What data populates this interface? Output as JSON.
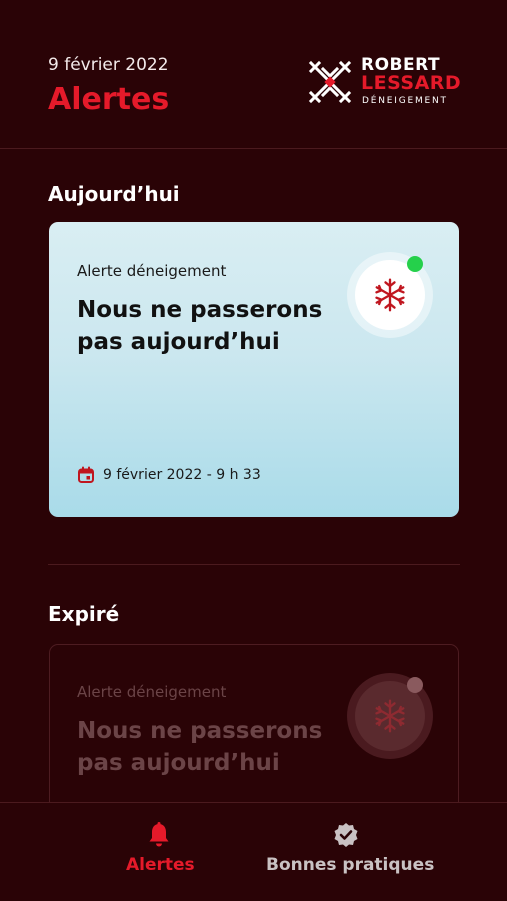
{
  "header": {
    "date": "9 février 2022",
    "title": "Alertes",
    "logo": {
      "line1": "ROBERT",
      "line2": "LESSARD",
      "line3": "DÉNEIGEMENT"
    }
  },
  "sections": {
    "today": "Aujourd’hui",
    "expired": "Expiré"
  },
  "today_card": {
    "kicker": "Alerte déneigement",
    "headline": "Nous ne passerons pas aujourd’hui",
    "timestamp": "9 février 2022 - 9 h 33",
    "status_color": "#25d04b",
    "icon": "snowflake-icon"
  },
  "expired_card": {
    "kicker": "Alerte déneigement",
    "headline": "Nous ne passerons pas aujourd’hui",
    "icon": "snowflake-icon"
  },
  "tabbar": {
    "tabs": [
      {
        "label": "Alertes",
        "icon": "bell-icon",
        "active": true
      },
      {
        "label": "Bonnes pratiques",
        "icon": "verified-badge-icon",
        "active": false
      }
    ]
  },
  "colors": {
    "accent": "#e51a2a",
    "background": "#2a0306"
  }
}
